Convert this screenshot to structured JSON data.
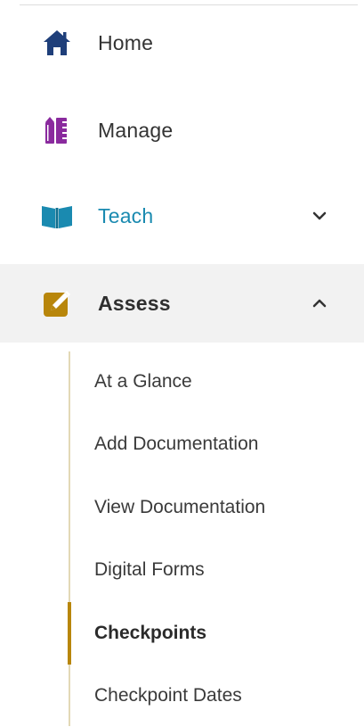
{
  "nav": {
    "items": [
      {
        "label": "Home",
        "icon": "home-icon",
        "color": "#1f3f7a"
      },
      {
        "label": "Manage",
        "icon": "pencil-ruler-icon",
        "color": "#8a2a9e"
      },
      {
        "label": "Teach",
        "icon": "book-icon",
        "color": "#1a8ab0"
      },
      {
        "label": "Assess",
        "icon": "edit-note-icon",
        "color": "#b8860b"
      }
    ],
    "teach_chevron": "chevron-down-icon",
    "assess_chevron": "chevron-up-icon"
  },
  "assess_menu": {
    "items": [
      {
        "label": "At a Glance"
      },
      {
        "label": "Add Documentation"
      },
      {
        "label": "View Documentation"
      },
      {
        "label": "Digital Forms"
      },
      {
        "label": "Checkpoints",
        "active": true
      },
      {
        "label": "Checkpoint Dates"
      }
    ]
  }
}
